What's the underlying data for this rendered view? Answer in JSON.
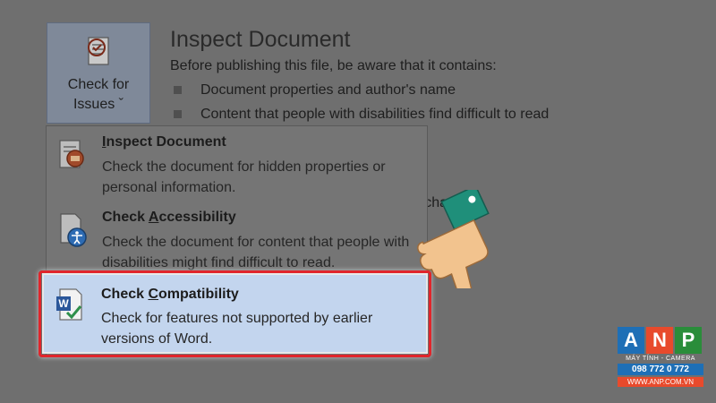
{
  "issues_button": {
    "label_line1": "Check for",
    "label_line2": "Issues ˇ"
  },
  "info": {
    "title": "Inspect Document",
    "description": "Before publishing this file, be aware that it contains:",
    "bullets": [
      "Document properties and author's name",
      "Content that people with disabilities find difficult to read"
    ],
    "partial_line": "ed changes."
  },
  "menu": {
    "items": [
      {
        "title_pre": "",
        "title_accel": "I",
        "title_post": "nspect Document",
        "desc": "Check the document for hidden properties or personal information."
      },
      {
        "title_pre": "Check ",
        "title_accel": "A",
        "title_post": "ccessibility",
        "desc": "Check the document for content that people with disabilities might find difficult to read."
      },
      {
        "title_pre": "Check ",
        "title_accel": "C",
        "title_post": "ompatibility",
        "desc": "Check for features not supported by earlier versions of Word."
      }
    ]
  },
  "logo": {
    "letter_a": "A",
    "letter_n": "N",
    "letter_p": "P",
    "subtitle": "MÁY TÍNH - CAMERA",
    "phone": "098 772 0 772",
    "website": "WWW.ANP.COM.VN"
  },
  "colors": {
    "highlight_border": "#e0252b",
    "selected_item_bg": "#c3d5ee"
  }
}
